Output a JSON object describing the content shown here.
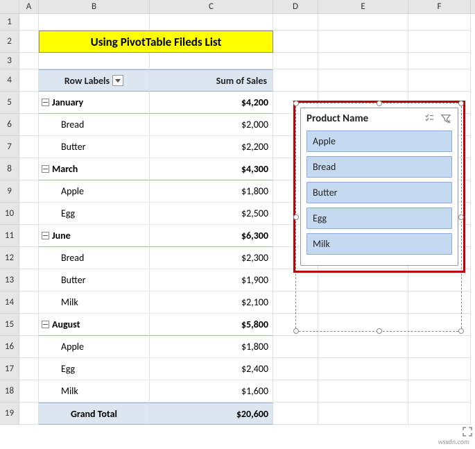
{
  "columns": [
    "A",
    "B",
    "C",
    "D",
    "E",
    "F"
  ],
  "col_widths": {
    "A": 28,
    "B": 160,
    "C": 178,
    "D": 65,
    "E": 130,
    "F": 90
  },
  "row_numbers": [
    1,
    2,
    3,
    4,
    5,
    6,
    7,
    8,
    9,
    10,
    11,
    12,
    13,
    14,
    15,
    16,
    17,
    18,
    19
  ],
  "title": "Using PivotTable Fileds List",
  "pivot_header": {
    "left": "Row Labels",
    "right": "Sum of Sales"
  },
  "pivot": [
    {
      "type": "group",
      "label": "January",
      "value": "$4,200",
      "items": [
        {
          "label": "Bread",
          "value": "$2,000"
        },
        {
          "label": "Butter",
          "value": "$2,200"
        }
      ]
    },
    {
      "type": "group",
      "label": "March",
      "value": "$4,300",
      "items": [
        {
          "label": "Apple",
          "value": "$1,800"
        },
        {
          "label": "Egg",
          "value": "$2,500"
        }
      ]
    },
    {
      "type": "group",
      "label": "June",
      "value": "$6,300",
      "items": [
        {
          "label": "Bread",
          "value": "$2,300"
        },
        {
          "label": "Butter",
          "value": "$1,900"
        },
        {
          "label": "Milk",
          "value": "$2,100"
        }
      ]
    },
    {
      "type": "group",
      "label": "August",
      "value": "$5,800",
      "items": [
        {
          "label": "Apple",
          "value": "$1,800"
        },
        {
          "label": "Egg",
          "value": "$2,400"
        },
        {
          "label": "Milk",
          "value": "$1,600"
        }
      ]
    }
  ],
  "grand_total": {
    "label": "Grand Total",
    "value": "$20,600"
  },
  "slicer": {
    "title": "Product Name",
    "items": [
      "Apple",
      "Bread",
      "Butter",
      "Egg",
      "Milk"
    ]
  },
  "watermark": "wsxdn.com"
}
